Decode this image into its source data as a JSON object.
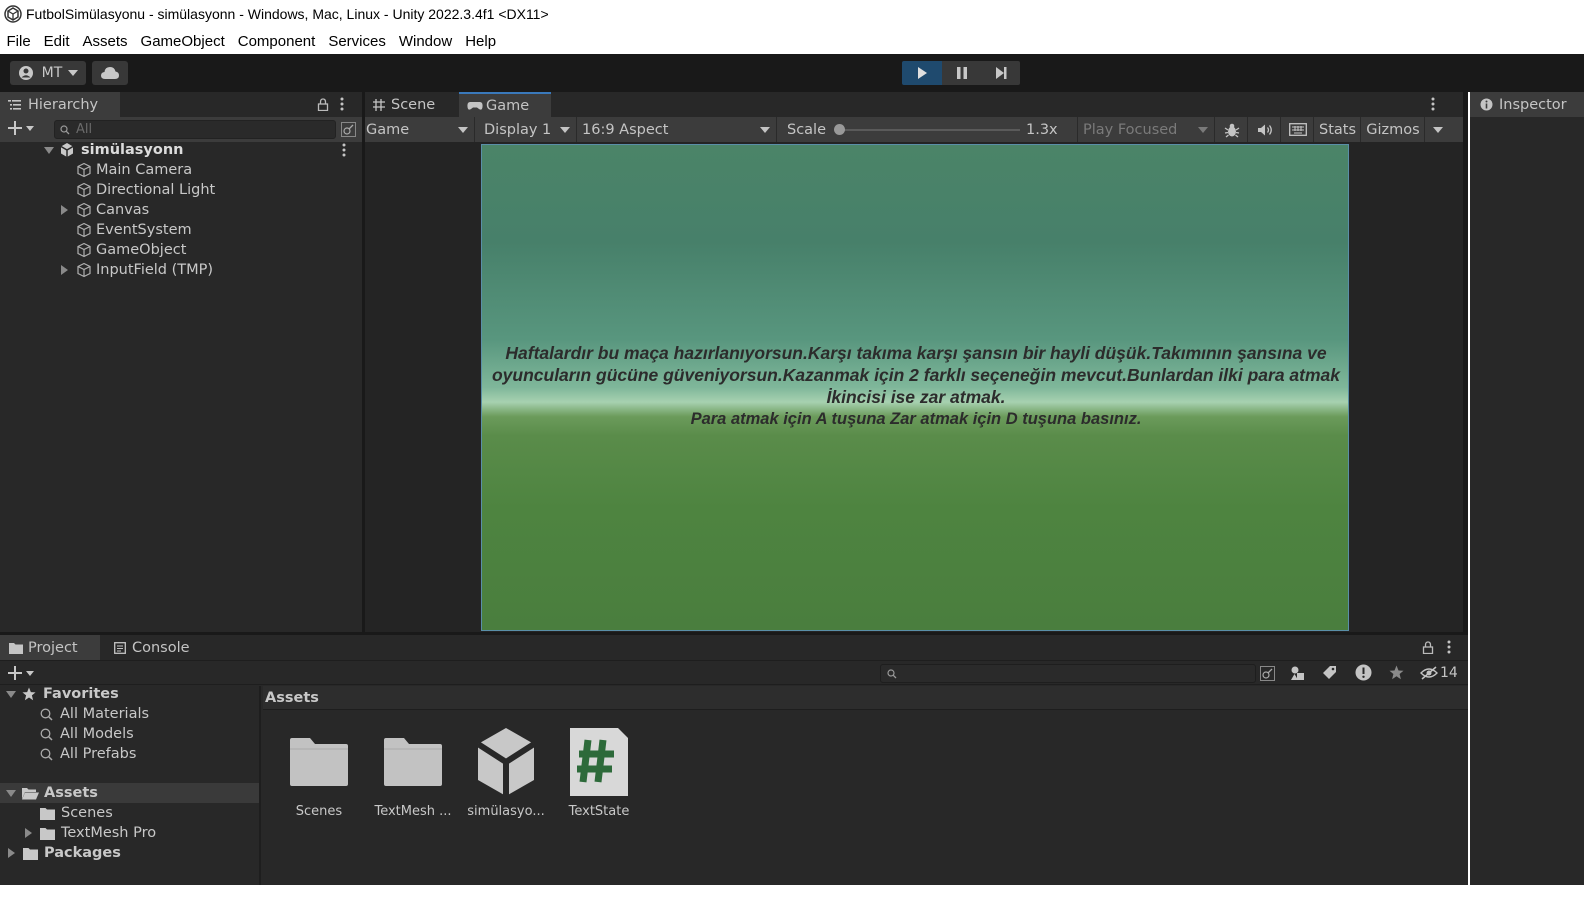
{
  "window": {
    "title": "FutbolSimülasyonu - simülasyonn - Windows, Mac, Linux - Unity 2022.3.4f1 <DX11>"
  },
  "menu": [
    "File",
    "Edit",
    "Assets",
    "GameObject",
    "Component",
    "Services",
    "Window",
    "Help"
  ],
  "toolbar": {
    "account_label": "MT",
    "play_state": "playing"
  },
  "hierarchy": {
    "tab_label": "Hierarchy",
    "search_placeholder": "All",
    "scene_name": "simülasyonn",
    "items": [
      {
        "label": "Main Camera",
        "expandable": false
      },
      {
        "label": "Directional Light",
        "expandable": false
      },
      {
        "label": "Canvas",
        "expandable": true
      },
      {
        "label": "EventSystem",
        "expandable": false
      },
      {
        "label": "GameObject",
        "expandable": false
      },
      {
        "label": "InputField (TMP)",
        "expandable": true
      }
    ]
  },
  "view_tabs": {
    "scene": "Scene",
    "game": "Game"
  },
  "game_bar": {
    "mode": "Game",
    "display": "Display 1",
    "aspect": "16:9 Aspect",
    "scale_label": "Scale",
    "scale_value": "1.3x",
    "play_focus": "Play Focused",
    "stats": "Stats",
    "gizmos": "Gizmos"
  },
  "game_view": {
    "lines": [
      "Haftalardır bu maça hazırlanıyorsun.Karşı takıma karşı şansın bir hayli düşük.Takımının şansına ve",
      "oyuncuların gücüne güveniyorsun.Kazanmak için 2 farklı seçeneğin mevcut.Bunlardan ilki para atmak",
      "İkincisi ise zar atmak.",
      "Para atmak için A tuşuna Zar atmak için D tuşuna basınız."
    ]
  },
  "inspector": {
    "tab_label": "Inspector"
  },
  "project": {
    "tabs": {
      "project": "Project",
      "console": "Console"
    },
    "hidden_count": "14",
    "favorites": {
      "label": "Favorites",
      "items": [
        "All Materials",
        "All Models",
        "All Prefabs"
      ]
    },
    "assets_root": {
      "label": "Assets",
      "children": [
        "Scenes",
        "TextMesh Pro"
      ]
    },
    "packages_label": "Packages",
    "breadcrumb": "Assets",
    "assets": [
      {
        "label": "Scenes",
        "kind": "folder"
      },
      {
        "label": "TextMesh ...",
        "kind": "folder"
      },
      {
        "label": "simülasyo...",
        "kind": "unity-scene"
      },
      {
        "label": "TextState",
        "kind": "csharp-script"
      }
    ]
  },
  "colors": {
    "play_active": "#1f4a6e",
    "panel": "#282828",
    "toolbar": "#191919",
    "script_hash": "#2d6a3a"
  }
}
